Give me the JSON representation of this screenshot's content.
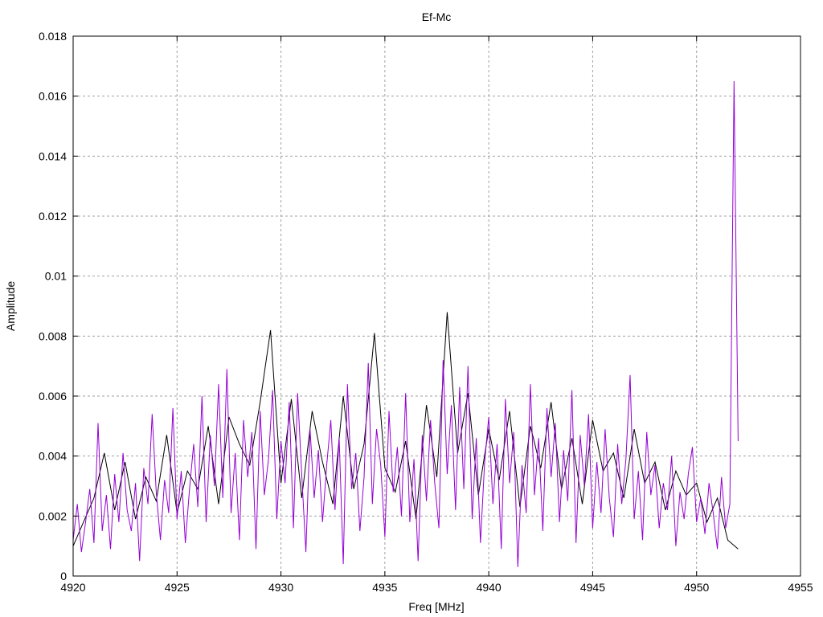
{
  "chart_data": {
    "type": "line",
    "title": "Ef-Mc",
    "xlabel": "Freq [MHz]",
    "ylabel": "Amplitude",
    "xlim": [
      4920,
      4955
    ],
    "ylim": [
      0,
      0.018
    ],
    "xticks": [
      "4920",
      "4925",
      "4930",
      "4935",
      "4940",
      "4945",
      "4950",
      "4955"
    ],
    "yticks": [
      "0",
      "0.002",
      "0.004",
      "0.006",
      "0.008",
      "0.01",
      "0.012",
      "0.014",
      "0.016",
      "0.018"
    ],
    "grid": true,
    "legend": "none",
    "series": [
      {
        "name": "black",
        "color": "#000000",
        "x_start": 4920,
        "x_step": 0.5,
        "values": [
          0.001,
          0.0018,
          0.0026,
          0.0041,
          0.0022,
          0.0038,
          0.0019,
          0.0033,
          0.0025,
          0.0047,
          0.0021,
          0.0035,
          0.0029,
          0.005,
          0.0024,
          0.0053,
          0.0044,
          0.0037,
          0.0058,
          0.0082,
          0.0031,
          0.0059,
          0.0026,
          0.0055,
          0.0038,
          0.0024,
          0.006,
          0.0029,
          0.0044,
          0.0081,
          0.0036,
          0.0028,
          0.0045,
          0.0019,
          0.0057,
          0.0033,
          0.0088,
          0.0041,
          0.0061,
          0.0027,
          0.0049,
          0.0032,
          0.0055,
          0.0023,
          0.005,
          0.0036,
          0.0058,
          0.0029,
          0.0046,
          0.0024,
          0.0052,
          0.0035,
          0.0041,
          0.0026,
          0.0049,
          0.0031,
          0.0038,
          0.0022,
          0.0035,
          0.0027,
          0.0031,
          0.0018,
          0.0026,
          0.0012,
          0.0009
        ]
      },
      {
        "name": "purple",
        "color": "#9400d3",
        "x_start": 4920,
        "x_step": 0.2,
        "values": [
          0.0012,
          0.0024,
          0.0008,
          0.0018,
          0.0029,
          0.0011,
          0.0051,
          0.0015,
          0.0027,
          0.0009,
          0.0034,
          0.0018,
          0.0041,
          0.0022,
          0.0015,
          0.0031,
          0.0005,
          0.0036,
          0.0024,
          0.0054,
          0.0028,
          0.0012,
          0.0032,
          0.0021,
          0.0056,
          0.0019,
          0.0035,
          0.0011,
          0.0029,
          0.0044,
          0.0023,
          0.006,
          0.0018,
          0.0047,
          0.003,
          0.0064,
          0.0026,
          0.0069,
          0.0021,
          0.0041,
          0.0012,
          0.0052,
          0.0033,
          0.0048,
          0.0009,
          0.0055,
          0.0027,
          0.0039,
          0.0062,
          0.0019,
          0.0045,
          0.0031,
          0.0058,
          0.0016,
          0.0061,
          0.0034,
          0.0008,
          0.0049,
          0.0026,
          0.0042,
          0.0018,
          0.0037,
          0.0052,
          0.0022,
          0.0046,
          0.0004,
          0.0064,
          0.0029,
          0.0041,
          0.0015,
          0.0033,
          0.0071,
          0.0024,
          0.0049,
          0.0037,
          0.0013,
          0.0055,
          0.0028,
          0.0043,
          0.002,
          0.0061,
          0.0018,
          0.0039,
          0.0005,
          0.0047,
          0.0025,
          0.0052,
          0.0031,
          0.0016,
          0.0072,
          0.0034,
          0.0057,
          0.0022,
          0.0063,
          0.0029,
          0.007,
          0.0019,
          0.0046,
          0.0011,
          0.0038,
          0.0053,
          0.0024,
          0.0044,
          0.0009,
          0.0059,
          0.0031,
          0.0048,
          0.0003,
          0.0037,
          0.0021,
          0.0064,
          0.0027,
          0.0046,
          0.0015,
          0.0056,
          0.0033,
          0.0051,
          0.0018,
          0.0042,
          0.0025,
          0.0062,
          0.0011,
          0.0047,
          0.003,
          0.0054,
          0.0016,
          0.0038,
          0.0021,
          0.0049,
          0.0026,
          0.0013,
          0.0044,
          0.0024,
          0.0039,
          0.0067,
          0.0019,
          0.0035,
          0.0012,
          0.0048,
          0.0027,
          0.0037,
          0.0016,
          0.0031,
          0.0022,
          0.004,
          0.001,
          0.0028,
          0.0019,
          0.0034,
          0.0043,
          0.0018,
          0.0026,
          0.0014,
          0.0031,
          0.0021,
          0.0009,
          0.0033,
          0.0016,
          0.0024,
          0.0165,
          0.0045
        ]
      }
    ]
  }
}
